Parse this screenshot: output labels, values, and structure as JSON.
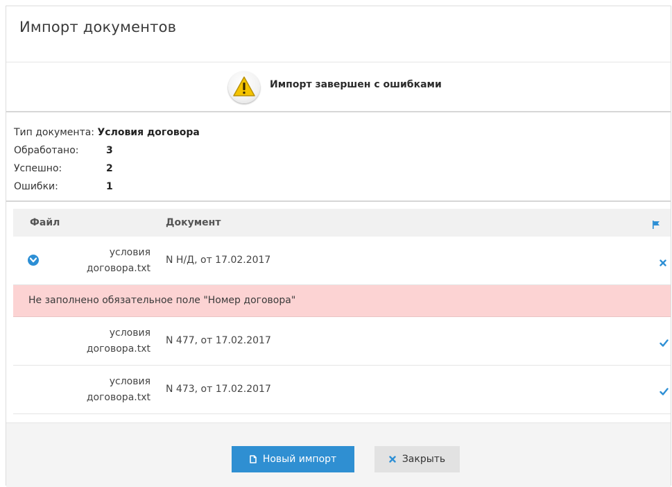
{
  "dialog": {
    "title": "Импорт документов"
  },
  "status": {
    "message": "Импорт завершен с ошибками",
    "icon": "warning-icon",
    "color": "#f5c400"
  },
  "summary": {
    "doc_type_label": "Тип документа:",
    "doc_type_value": "Условия договора",
    "processed_label": "Обработано:",
    "processed_value": "3",
    "success_label": "Успешно:",
    "success_value": "2",
    "errors_label": "Ошибки:",
    "errors_value": "1"
  },
  "table": {
    "columns": {
      "file": "Файл",
      "document": "Документ"
    },
    "rows": [
      {
        "file_line1": "условия",
        "file_line2": "договора.txt",
        "document": "N Н/Д, от 17.02.2017",
        "status": "error"
      },
      {
        "file_line1": "условия",
        "file_line2": "договора.txt",
        "document": "N 477, от 17.02.2017",
        "status": "ok"
      },
      {
        "file_line1": "условия",
        "file_line2": "договора.txt",
        "document": "N 473, от 17.02.2017",
        "status": "ok"
      }
    ],
    "error_message": "Не заполнено обязательное поле \"Номер договора\""
  },
  "footer": {
    "new_import_label": "Новый импорт",
    "close_label": "Закрыть"
  },
  "colors": {
    "accent": "#2f8fd2",
    "error_bg": "#fcd3d3"
  }
}
